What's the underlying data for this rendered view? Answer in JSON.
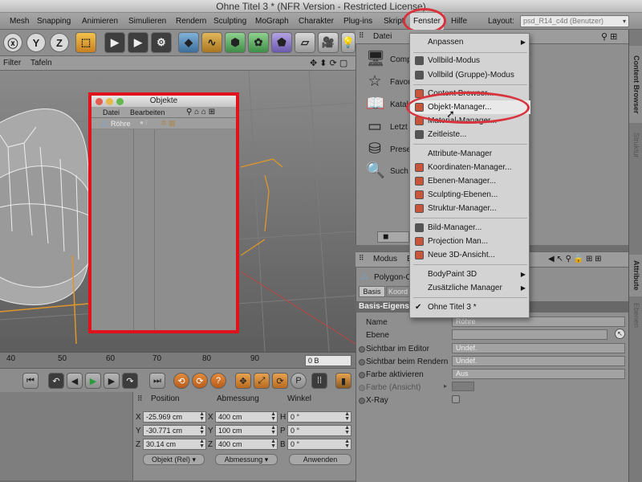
{
  "window": {
    "title": "Ohne Titel 3 * (NFR Version - Restricted License)"
  },
  "menubar": {
    "items": [
      "Mesh",
      "Snapping",
      "Animieren",
      "Simulieren",
      "Rendern",
      "Sculpting",
      "MoGraph",
      "Charakter",
      "Plug-ins",
      "Skript",
      "Fenster",
      "Hilfe"
    ],
    "active": "Fenster",
    "layout_label": "Layout:",
    "layout_value": "psd_R14_c4d (Benutzer)"
  },
  "toolbar": {
    "y_label": "Y",
    "z_label": "Z"
  },
  "viewport": {
    "menu": [
      "Filter",
      "Tafeln"
    ]
  },
  "object_manager": {
    "title": "Objekte",
    "menu": [
      "Datei",
      "Bearbeiten"
    ],
    "row_name": "Röhre"
  },
  "timeline": {
    "tick_labels": [
      "40",
      "50",
      "60",
      "70",
      "80",
      "90"
    ],
    "frame": "0 B"
  },
  "coords": {
    "headers": {
      "position": "Position",
      "size": "Abmessung",
      "angle": "Winkel"
    },
    "axes_pos": [
      "X",
      "Y",
      "Z"
    ],
    "axes_size": [
      "X",
      "Y",
      "Z"
    ],
    "axes_angle": [
      "H",
      "P",
      "B"
    ],
    "pos_values": [
      "-25.969 cm",
      "-30.771 cm",
      "30.14 cm"
    ],
    "size_values": [
      "400 cm",
      "100 cm",
      "400 cm"
    ],
    "angle_values": [
      "0 °",
      "0 °",
      "0 °"
    ],
    "mode_buttons": [
      "Objekt (Rel)",
      "Abmessung"
    ],
    "apply_button": "Anwenden"
  },
  "content_browser": {
    "menu": [
      "Datei"
    ],
    "rows": [
      "Comp",
      "Favor",
      "Katal",
      "Letzt",
      "Prese",
      "Such"
    ]
  },
  "attributes": {
    "menu": [
      "Modus",
      "E"
    ],
    "object": "Polygon-O",
    "tabs": [
      "Basis",
      "Koord"
    ],
    "section": "Basis-Eigens",
    "name_label": "Name",
    "name_value": "Röhre",
    "layer_label": "Ebene",
    "editor_label": "Sichtbar im Editor",
    "editor_value": "Undef.",
    "render_label": "Sichtbar beim Rendern",
    "render_value": "Undef.",
    "color_label": "Farbe aktivieren",
    "color_value": "Aus",
    "color_view_label": "Farbe (Ansicht)",
    "xray_label": "X-Ray"
  },
  "side_tabs": [
    "Content Browser",
    "Struktur",
    "Attribute",
    "Ebenen"
  ],
  "fenster_menu": {
    "items": [
      {
        "label": "Anpassen",
        "arrow": true
      },
      {
        "label": "Vollbild-Modus"
      },
      {
        "label": "Vollbild (Gruppe)-Modus"
      },
      {
        "label": "Content Browser..."
      },
      {
        "label": "Objekt-Manager...",
        "highlighted": true
      },
      {
        "label": "Material-Manager..."
      },
      {
        "label": "Zeitleiste..."
      },
      {
        "label": "Attribute-Manager"
      },
      {
        "label": "Koordinaten-Manager..."
      },
      {
        "label": "Ebenen-Manager..."
      },
      {
        "label": "Sculpting-Ebenen..."
      },
      {
        "label": "Struktur-Manager..."
      },
      {
        "label": "Bild-Manager..."
      },
      {
        "label": "Projection Man..."
      },
      {
        "label": "Neue 3D-Ansicht..."
      },
      {
        "label": "BodyPaint 3D",
        "arrow": true
      },
      {
        "label": "Zusätzliche Manager",
        "arrow": true
      },
      {
        "label": "Ohne Titel 3 *",
        "checked": true
      }
    ]
  },
  "colors": {
    "highlight_red": "#d8333d",
    "frame_red": "#e0121b",
    "tube_orange": "#e0962a"
  }
}
